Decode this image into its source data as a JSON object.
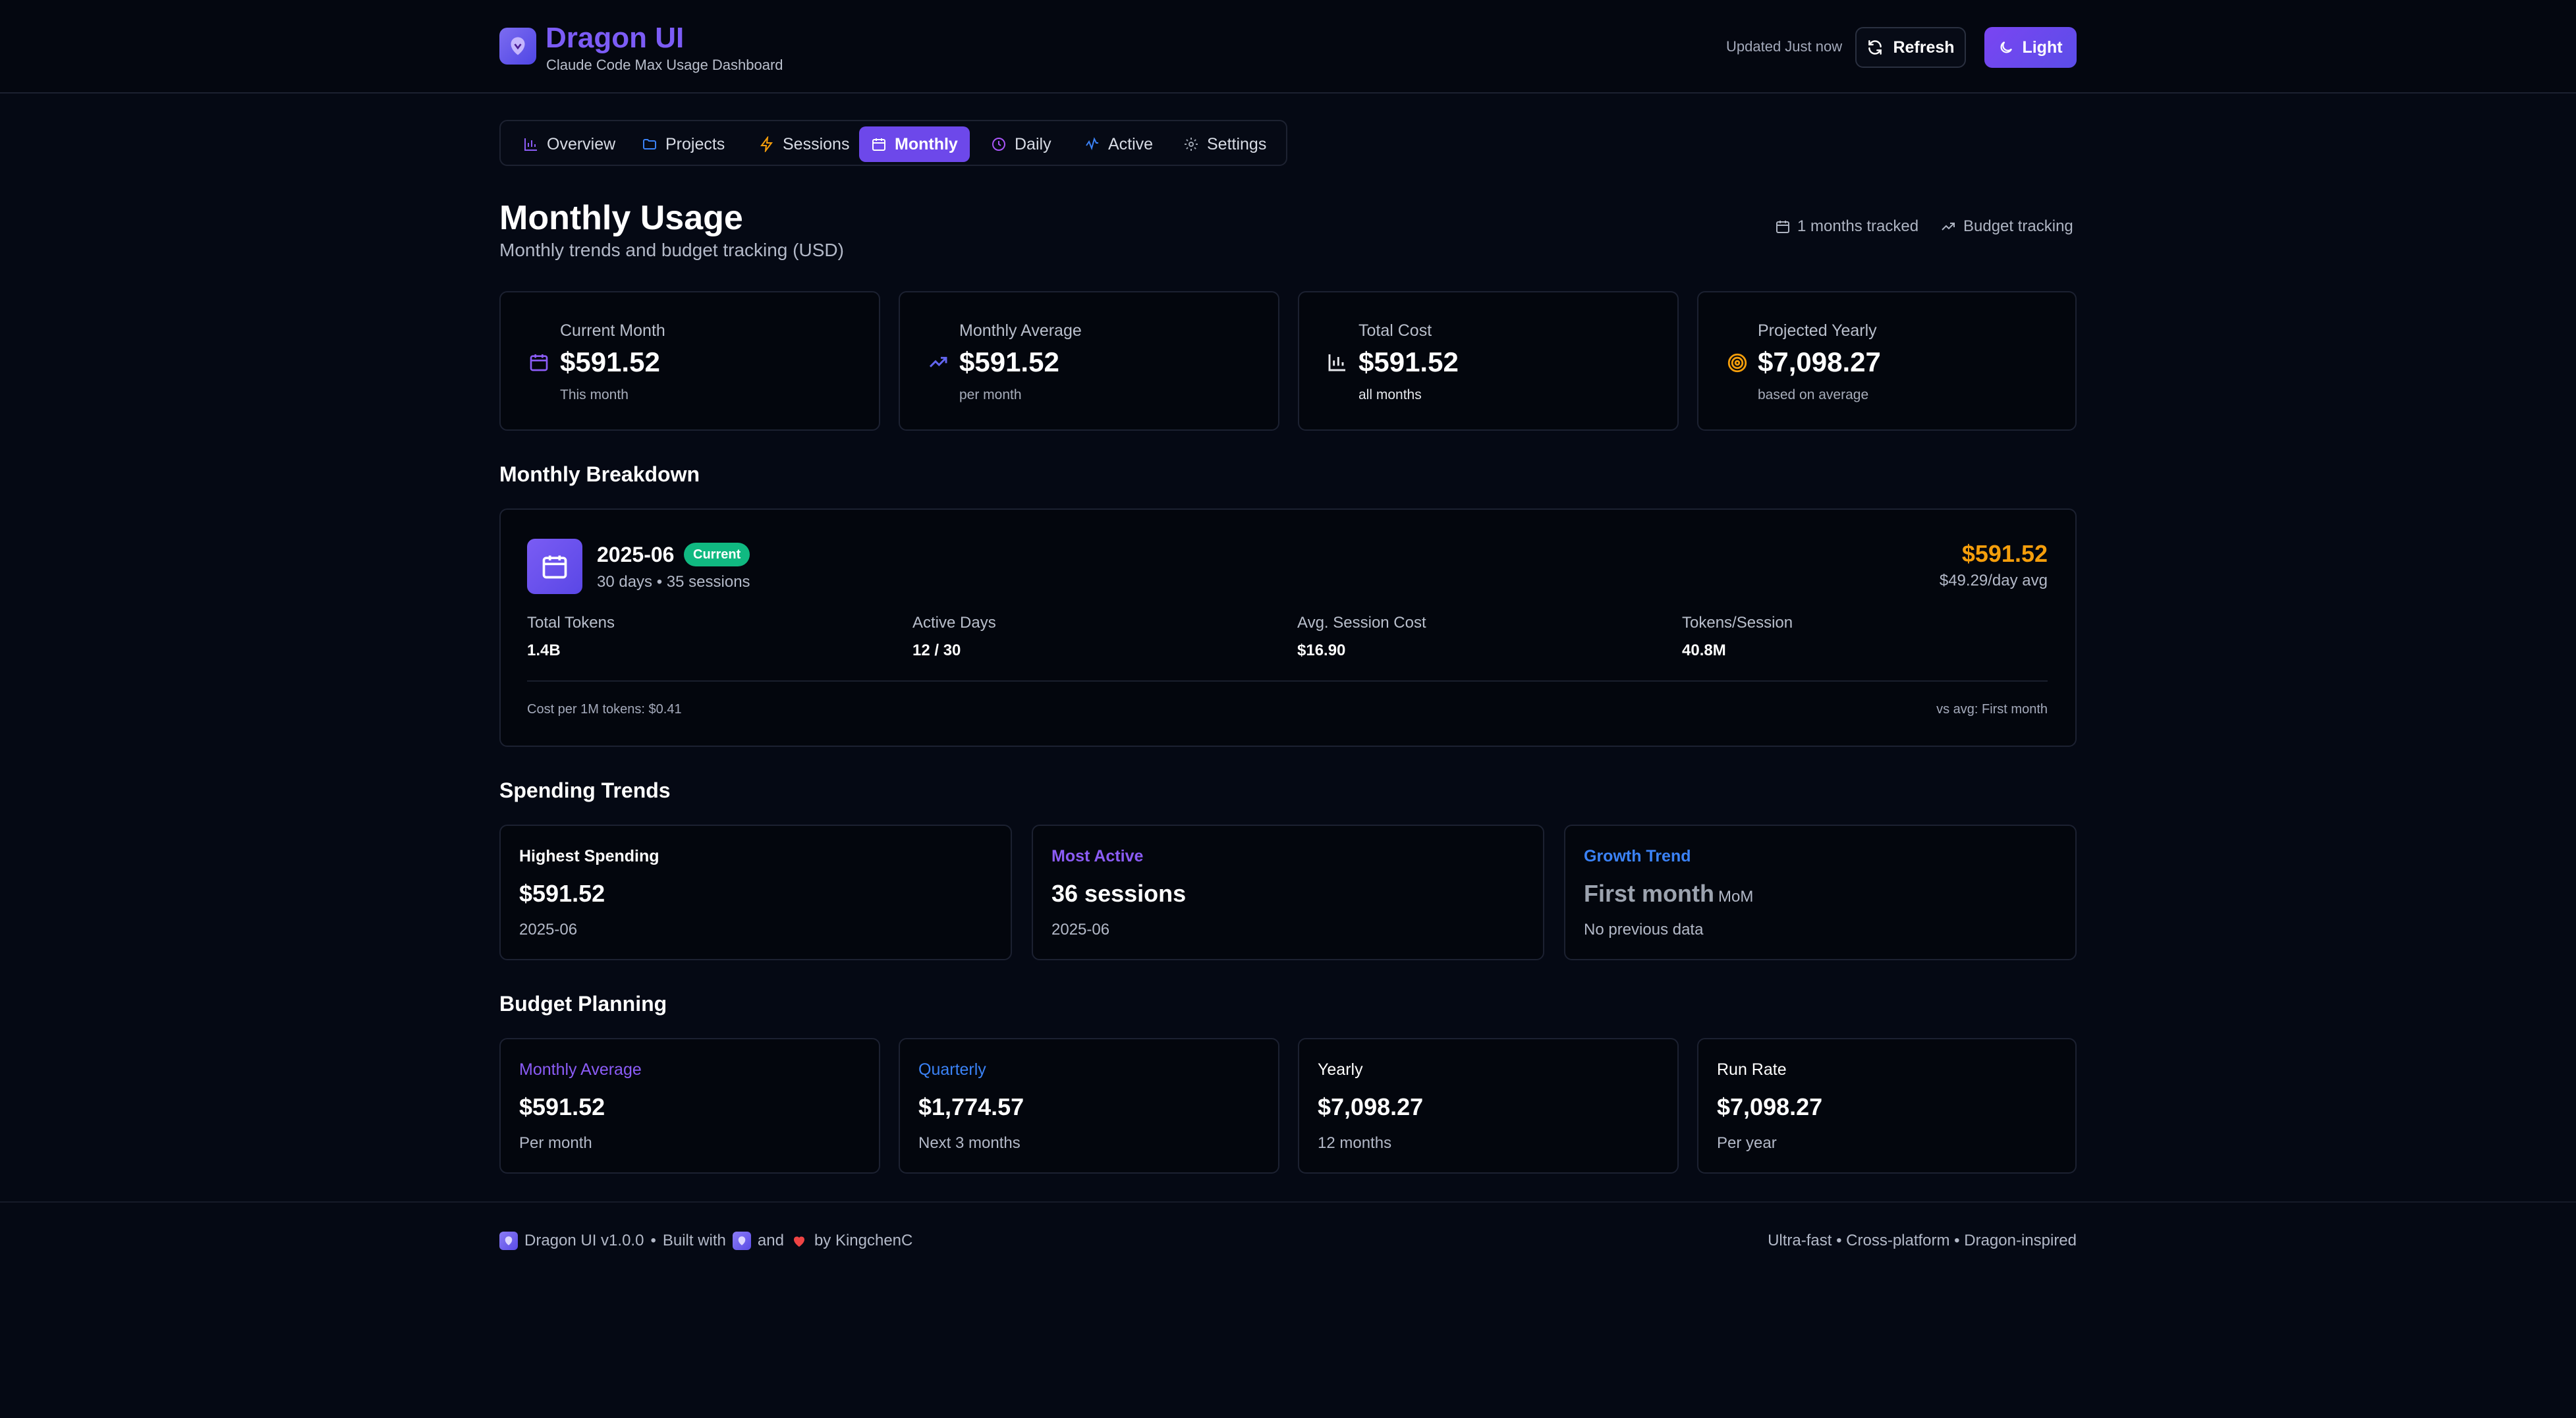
{
  "header": {
    "brand": "Dragon UI",
    "tagline": "Claude Code Max Usage Dashboard",
    "updated": "Updated Just now",
    "refresh_label": "Refresh",
    "theme_label": "Light"
  },
  "tabs": [
    {
      "label": "Overview",
      "icon": "bar-chart-icon"
    },
    {
      "label": "Projects",
      "icon": "folder-icon"
    },
    {
      "label": "Sessions",
      "icon": "lightning-icon"
    },
    {
      "label": "Monthly",
      "icon": "calendar-icon",
      "active": true
    },
    {
      "label": "Daily",
      "icon": "clock-icon"
    },
    {
      "label": "Active",
      "icon": "activity-icon"
    },
    {
      "label": "Settings",
      "icon": "gear-icon"
    }
  ],
  "page": {
    "title": "Monthly Usage",
    "subtitle": "Monthly trends and budget tracking (USD)",
    "months_tracked": "1 months tracked",
    "budget_tracking": "Budget tracking"
  },
  "stats": [
    {
      "label": "Current Month",
      "value": "$591.52",
      "foot": "This month",
      "icon": "calendar-icon",
      "color": "#8b5cf6"
    },
    {
      "label": "Monthly Average",
      "value": "$591.52",
      "foot": "per month",
      "icon": "trending-up-icon",
      "color": "#6366f1"
    },
    {
      "label": "Total Cost",
      "value": "$591.52",
      "foot": "all months",
      "icon": "bar-chart-icon",
      "color": "#e5e7eb"
    },
    {
      "label": "Projected Yearly",
      "value": "$7,098.27",
      "foot": "based on average",
      "icon": "target-icon",
      "color": "#f59e0b"
    }
  ],
  "breakdown": {
    "title": "Monthly Breakdown",
    "month": "2025-06",
    "badge": "Current",
    "sub": "30 days • 35 sessions",
    "cost": "$591.52",
    "avg": "$49.29/day avg",
    "metrics": [
      {
        "label": "Total Tokens",
        "value": "1.4B"
      },
      {
        "label": "Active Days",
        "value": "12 / 30"
      },
      {
        "label": "Avg. Session Cost",
        "value": "$16.90"
      },
      {
        "label": "Tokens/Session",
        "value": "40.8M"
      }
    ],
    "cost_per_m": "Cost per 1M tokens: $0.41",
    "vs_avg": "vs avg: First month"
  },
  "trends": {
    "title": "Spending Trends",
    "cards": [
      {
        "label": "Highest Spending",
        "value": "$591.52",
        "sub": "2025-06",
        "color": "#ffffff"
      },
      {
        "label": "Most Active",
        "value": "36 sessions",
        "sub": "2025-06",
        "color": "#8b5cf6"
      },
      {
        "label": "Growth Trend",
        "value": "First month",
        "unit": "MoM",
        "sub": "No previous data",
        "color": "#3b82f6"
      }
    ]
  },
  "budget": {
    "title": "Budget Planning",
    "cards": [
      {
        "label": "Monthly Average",
        "value": "$591.52",
        "sub": "Per month",
        "color": "#8b5cf6"
      },
      {
        "label": "Quarterly",
        "value": "$1,774.57",
        "sub": "Next 3 months",
        "color": "#3b82f6"
      },
      {
        "label": "Yearly",
        "value": "$7,098.27",
        "sub": "12 months",
        "color": "#ffffff"
      },
      {
        "label": "Run Rate",
        "value": "$7,098.27",
        "sub": "Per year",
        "color": "#ffffff"
      }
    ]
  },
  "footer": {
    "version": "Dragon UI v1.0.0",
    "built_with": "Built with",
    "and": "and",
    "by": "by KingchenC",
    "tagline": "Ultra-fast • Cross-platform • Dragon-inspired"
  }
}
